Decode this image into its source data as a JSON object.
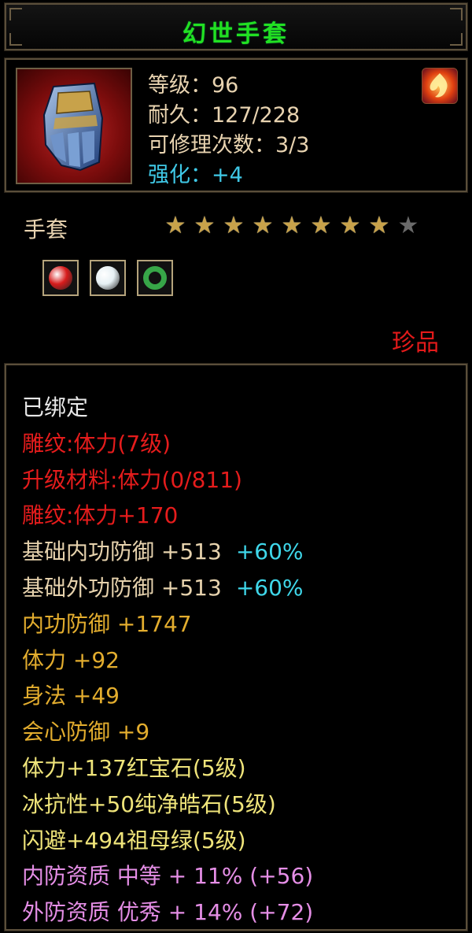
{
  "title": "幻世手套",
  "item": {
    "icon": "gauntlet-icon",
    "level": "等级：96",
    "durability": "耐久：127/228",
    "repair": "可修理次数：3/3",
    "enhance": "强化：+4",
    "badge_icon": "flame-icon",
    "type": "手套",
    "stars_total": 9,
    "stars_filled": 8,
    "rarity": "珍品"
  },
  "gems": [
    {
      "icon": "ruby-gem-icon",
      "color": "#d81c1c"
    },
    {
      "icon": "diamond-gem-icon",
      "color": "#e6f0f4"
    },
    {
      "icon": "emerald-ring-icon",
      "color": "#37a648"
    }
  ],
  "details": [
    {
      "text": "已绑定",
      "color": "white"
    },
    {
      "text": "雕纹:体力(7级)",
      "color": "red"
    },
    {
      "text": "升级材料:体力(0/811)",
      "color": "red"
    },
    {
      "text": "雕纹:体力+170",
      "color": "red"
    },
    {
      "text": "基础内功防御 +513",
      "bonus": "+60%",
      "color": "cream"
    },
    {
      "text": "基础外功防御 +513",
      "bonus": "+60%",
      "color": "cream"
    },
    {
      "text": "内功防御 +1747",
      "color": "gold"
    },
    {
      "text": "体力 +92",
      "color": "gold"
    },
    {
      "text": "身法 +49",
      "color": "gold"
    },
    {
      "text": "会心防御 +9",
      "color": "gold"
    },
    {
      "text": "体力+137红宝石(5级)",
      "color": "yellow"
    },
    {
      "text": "冰抗性+50纯净皓石(5级)",
      "color": "yellow"
    },
    {
      "text": "闪避+494祖母绿(5级)",
      "color": "yellow"
    },
    {
      "text": "内防资质 中等 + 11% (+56)",
      "color": "pink"
    },
    {
      "text": "外防资质 优秀 + 14% (+72)",
      "color": "pink"
    }
  ]
}
